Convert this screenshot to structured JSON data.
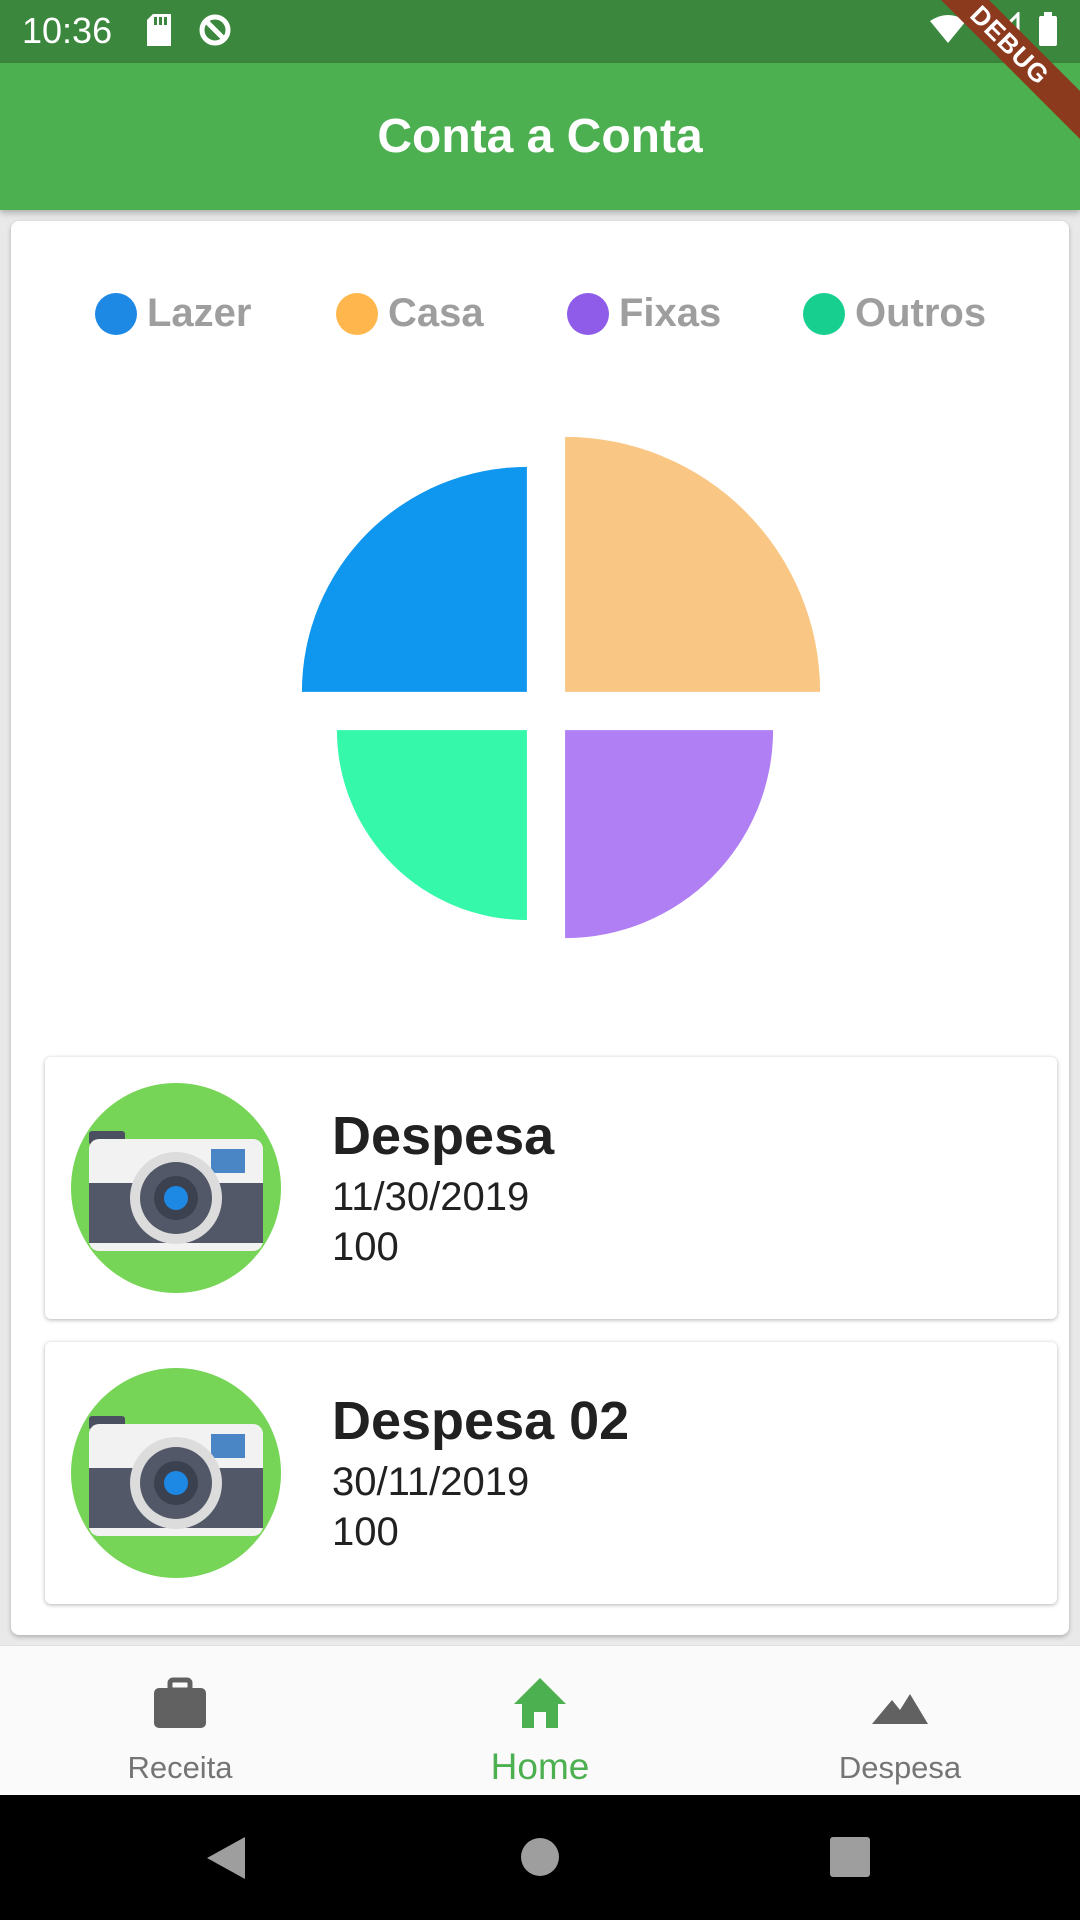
{
  "status_bar": {
    "time": "10:36"
  },
  "app_bar": {
    "title": "Conta a Conta",
    "debug_label": "DEBUG"
  },
  "legend": [
    {
      "label": "Lazer",
      "color": "#1e88e5"
    },
    {
      "label": "Casa",
      "color": "#ffb74d"
    },
    {
      "label": "Fixas",
      "color": "#8e5ce8"
    },
    {
      "label": "Outros",
      "color": "#17d08f"
    }
  ],
  "chart_data": {
    "type": "pie",
    "slices": [
      {
        "label": "Lazer",
        "value": 25,
        "color": "#0f96ee"
      },
      {
        "label": "Casa",
        "value": 25,
        "color": "#f9c684"
      },
      {
        "label": "Fixas",
        "value": 25,
        "color": "#b07ff3"
      },
      {
        "label": "Outros",
        "value": 25,
        "color": "#35f8ab"
      }
    ]
  },
  "expenses": [
    {
      "title": "Despesa",
      "date": "11/30/2019",
      "value": "100",
      "icon": "camera-icon"
    },
    {
      "title": "Despesa 02",
      "date": "30/11/2019",
      "value": "100",
      "icon": "camera-icon"
    }
  ],
  "bottom_nav": {
    "items": [
      {
        "label": "Receita",
        "icon": "briefcase-icon"
      },
      {
        "label": "Home",
        "icon": "home-icon",
        "active": true
      },
      {
        "label": "Despesa",
        "icon": "landscape-icon"
      }
    ]
  },
  "colors": {
    "primary": "#4caf50",
    "status_bar": "#3b873e",
    "active_nav": "#4caf50"
  }
}
